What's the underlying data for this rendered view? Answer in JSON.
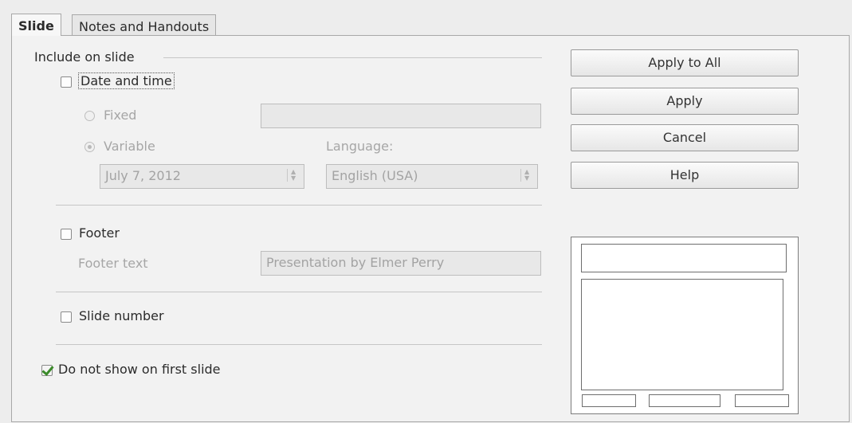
{
  "tabs": [
    {
      "label": "Slide",
      "active": true
    },
    {
      "label": "Notes and Handouts",
      "active": false
    }
  ],
  "include_section": {
    "title": "Include on slide"
  },
  "date_time": {
    "label": "Date and time",
    "checked": false,
    "fixed_label": "Fixed",
    "fixed_value": "",
    "variable_label": "Variable",
    "variable_selected": true,
    "language_label": "Language:",
    "format_value": "July 7, 2012",
    "language_value": "English (USA)"
  },
  "footer": {
    "label": "Footer",
    "checked": false,
    "text_label": "Footer text",
    "text_value": "Presentation by Elmer Perry"
  },
  "slide_number": {
    "label": "Slide number",
    "checked": false
  },
  "first_slide": {
    "label": "Do not show on first slide",
    "checked": true
  },
  "buttons": {
    "apply_all": "Apply to All",
    "apply": "Apply",
    "cancel": "Cancel",
    "help": "Help"
  },
  "icons": [
    "checkbox",
    "radio-button",
    "spin-arrows-icon",
    "layout-preview"
  ],
  "colors": {
    "check_mark": "#3b8a2a",
    "disabled_text": "#a6a6a6"
  }
}
